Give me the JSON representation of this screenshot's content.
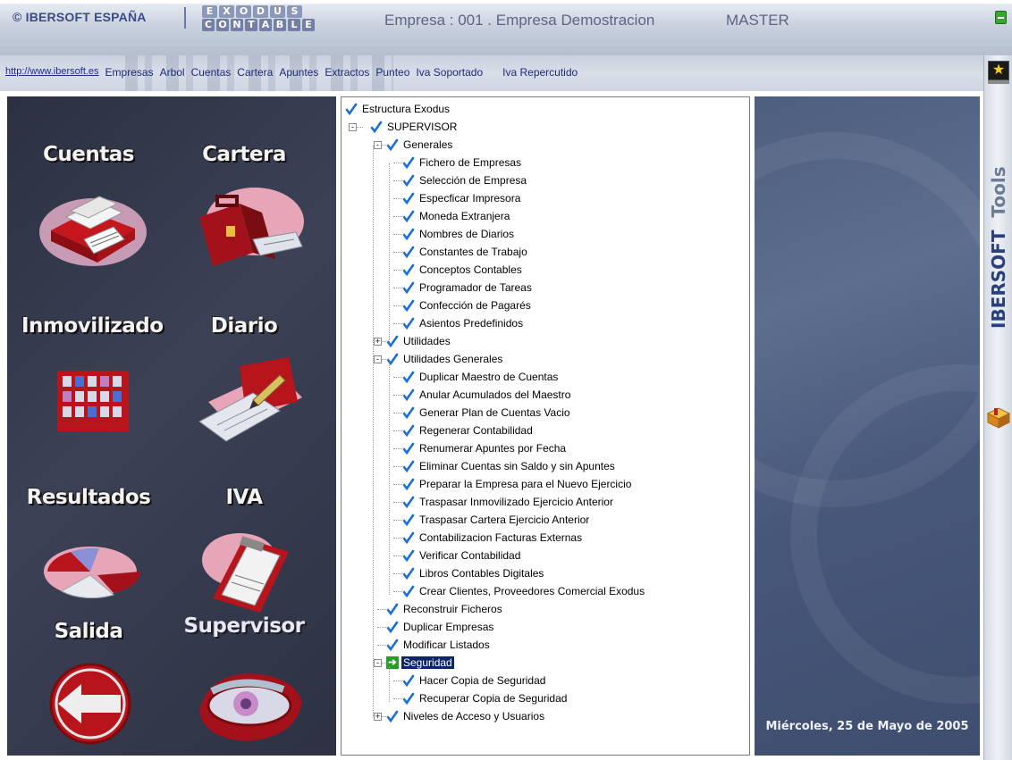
{
  "header": {
    "logo_ibersoft": "© IBERSOFT ESPAÑA",
    "logo_exodus_top": [
      "E",
      "X",
      "O",
      "D",
      "U",
      "S"
    ],
    "logo_exodus_bottom": [
      "C",
      "O",
      "N",
      "T",
      "A",
      "B",
      "L",
      "E"
    ],
    "empresa": "Empresa : 001 . Empresa Demostracion",
    "user": "MASTER"
  },
  "navbar": {
    "url": "http://www.ibersoft.es",
    "items": [
      "Empresas",
      "Arbol",
      "Cuentas",
      "Cartera",
      "Apuntes",
      "Extractos",
      "Punteo",
      "Iva Soportado",
      "Iva Repercutido"
    ]
  },
  "tools": {
    "brand": "IBERSOFT",
    "label": "Tools"
  },
  "left_panel": {
    "tiles": [
      {
        "label": "Cuentas",
        "icon": "accounts-printer-icon"
      },
      {
        "label": "Cartera",
        "icon": "briefcase-icon"
      },
      {
        "label": "Inmovilizado",
        "icon": "building-icon"
      },
      {
        "label": "Diario",
        "icon": "journal-pen-icon"
      },
      {
        "label": "Resultados",
        "icon": "pie-chart-icon"
      },
      {
        "label": "IVA",
        "icon": "clipboard-icon"
      },
      {
        "label": "Salida",
        "icon": "exit-arrow-icon"
      },
      {
        "label": "Supervisor",
        "icon": "eye-icon"
      }
    ]
  },
  "tree": {
    "root": "Estructura Exodus",
    "supervisor": "SUPERVISOR",
    "generales": "Generales",
    "generales_items": [
      "Fichero de Empresas",
      "Selección de Empresa",
      "Especficar Impresora",
      "Moneda Extranjera",
      "Nombres de Diarios",
      "Constantes de Trabajo",
      "Conceptos Contables",
      "Programador de Tareas",
      "Confección de Pagarés",
      "Asientos Predefinidos"
    ],
    "utilidades": "Utilidades",
    "utilidades_generales": "Utilidades Generales",
    "utilidades_generales_items": [
      "Duplicar Maestro de Cuentas",
      "Anular Acumulados del Maestro",
      "Generar Plan de Cuentas Vacio",
      "Regenerar Contabilidad",
      "Renumerar Apuntes por Fecha",
      "Eliminar Cuentas sin Saldo y sin Apuntes",
      "Preparar la Empresa para el Nuevo Ejercicio",
      "Traspasar Inmovilizado Ejercicio Anterior",
      "Traspasar Cartera Ejercicio Anterior",
      "Contabilizacion Facturas Externas",
      "Verificar Contabilidad",
      "Libros Contables Digitales",
      "Crear Clientes, Proveedores Comercial Exodus"
    ],
    "reconstruir": "Reconstruir Ficheros",
    "duplicar_empresas": "Duplicar Empresas",
    "modificar_listados": "Modificar Listados",
    "seguridad": "Seguridad",
    "seguridad_items": [
      "Hacer Copia de Seguridad",
      "Recuperar Copia de Seguridad"
    ],
    "niveles": "Niveles de Acceso y Usuarios"
  },
  "status": {
    "date": "Miércoles, 25 de Mayo de 2005"
  },
  "colors": {
    "accent": "#0a246a",
    "check": "#1a6fd6",
    "panel": "#34394d"
  }
}
